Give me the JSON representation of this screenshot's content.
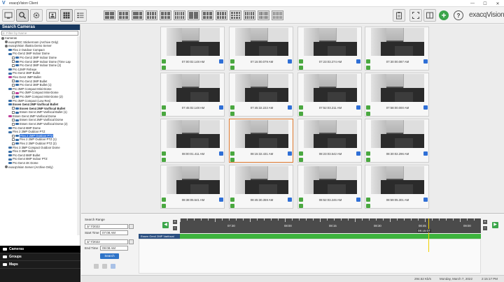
{
  "window": {
    "title": "exacqVision Client",
    "minimize": "—",
    "maximize": "☐",
    "close": "✕"
  },
  "toolbar": {
    "brand": "exacqVision",
    "help": "?",
    "plus": "+"
  },
  "search_panel": {
    "title": "Search Cameras",
    "filter_placeholder": "Filter by Name",
    "tree": [
      {
        "label": "Cameras",
        "kind": "root",
        "indent": 0
      },
      {
        "label": "exacqREC Stickerroom (Archive Only)",
        "kind": "server",
        "indent": 1
      },
      {
        "label": "exacqVision Illustra Demo Server",
        "kind": "server",
        "indent": 1
      },
      {
        "label": "Flex 2 Outdoor Compact",
        "kind": "cam",
        "indent": 2
      },
      {
        "label": "Pro Gen2 3MP Indoor Dome",
        "kind": "cam",
        "indent": 2
      },
      {
        "label": "Pro Gen2 3MP Indoor Dome",
        "kind": "cam",
        "indent": 3
      },
      {
        "label": "Pro Gen2 3MP Indoor Dome (Time Lap",
        "kind": "cam",
        "indent": 3
      },
      {
        "label": "Pro Gen2 3MP Indoor Dome (2)",
        "kind": "cam",
        "indent": 3
      },
      {
        "label": "Pro 12MP Fisheye",
        "kind": "cam",
        "indent": 2
      },
      {
        "label": "Pro Gen2 3MP Bullet",
        "kind": "cam",
        "indent": 2
      },
      {
        "label": "Flex Gen2 3MP Bullet",
        "kind": "cam-pink",
        "indent": 2
      },
      {
        "label": "Pro Gen2 3MP Bullet",
        "kind": "cam",
        "indent": 3
      },
      {
        "label": "Pro Gen2 3MP Bullet (1)",
        "kind": "cam",
        "indent": 3
      },
      {
        "label": "Pro 3MP Compact Mini-Dome",
        "kind": "cam",
        "indent": 2
      },
      {
        "label": "Pro 3MP Compact Mini-Dome",
        "kind": "cam-pink",
        "indent": 3
      },
      {
        "label": "Pro 3MP Compact Mini-Dome (2)",
        "kind": "cam",
        "indent": 3
      },
      {
        "label": "Pro 3MP Compact (Low Res)",
        "kind": "cam",
        "indent": 2
      },
      {
        "label": "Essen Gen4 2MP Varifocal Bullet",
        "kind": "cam",
        "indent": 2,
        "bold": true
      },
      {
        "label": "Essen Gen4 2MP Varifocal Bullet",
        "kind": "cam",
        "indent": 3,
        "bold": true
      },
      {
        "label": "Essen Gen4 2MP Varifocal Bullet (1)",
        "kind": "cam",
        "indent": 3
      },
      {
        "label": "Essen Gen4 2MP Varifocal Dome",
        "kind": "cam-pink",
        "indent": 2
      },
      {
        "label": "Essen Gen4 2MP Varifocal Dome",
        "kind": "cam",
        "indent": 3
      },
      {
        "label": "Essen Gen4 2MP Varifocal Dome (2)",
        "kind": "cam",
        "indent": 3
      },
      {
        "label": "Pro Gen3 8MP Dome",
        "kind": "cam",
        "indent": 2
      },
      {
        "label": "Flex 2 2MP Outdoor PTZ",
        "kind": "cam",
        "indent": 2
      },
      {
        "label": "Flex 2 2MP Outdoor PTZ",
        "kind": "cam",
        "indent": 3,
        "highlight": true
      },
      {
        "label": "Flex 2 2MP Outdoor PTZ (1)",
        "kind": "cam",
        "indent": 3
      },
      {
        "label": "Flex 2 2MP Outdoor PTZ (2)",
        "kind": "cam",
        "indent": 3
      },
      {
        "label": "Flex 3 3MP Compact Outdoor Dome",
        "kind": "cam",
        "indent": 2
      },
      {
        "label": "Flex 3 3MP Bullet",
        "kind": "cam",
        "indent": 2
      },
      {
        "label": "Pro Gen3 8MP Bullet",
        "kind": "cam",
        "indent": 2
      },
      {
        "label": "Pro Gen4 8MP Indoor PTZ",
        "kind": "cam",
        "indent": 2
      },
      {
        "label": "Pro Gen4 4K Dome",
        "kind": "cam",
        "indent": 2
      },
      {
        "label": "exacqVision Server (Archive Only)",
        "kind": "server",
        "indent": 1
      }
    ]
  },
  "nav": [
    {
      "label": "Cameras",
      "active": true
    },
    {
      "label": "Groups",
      "active": false
    },
    {
      "label": "Maps",
      "active": false
    }
  ],
  "thumbnails": [
    "07:00:02.148 AM",
    "07:15:00.079 AM",
    "07:23:03.274 AM",
    "07:30:00.087 AM",
    "07:45:02.148 AM",
    "07:45:32.222 AM",
    "07:52:03.211 AM",
    "07:58:00.000 AM",
    "08:00:01.411 AM",
    "08:15:32.431 AM",
    "08:23:03.542 AM",
    "08:30:02.296 AM",
    "08:38:05.541 AM",
    "08:45:30.359 AM",
    "08:52:03.246 AM",
    "08:59:05.301 AM"
  ],
  "selected_thumbnail": 9,
  "search": {
    "range_label": "Search Range",
    "start_date": "3/ 7/2022",
    "start_time_label": "Start Time",
    "start_time": "07:08 AM",
    "end_date": "3/ 7/2022",
    "end_time_label": "End Time",
    "end_time": "09:08 AM",
    "search_button": "Search"
  },
  "timeline": {
    "ticks": [
      "07:30",
      "08:00",
      "08:15",
      "08:30",
      "08:45",
      "09:00"
    ],
    "marker_label": "08:15:07",
    "track_name": "Essen Gen4 2MP Varifocal",
    "prev": "◀",
    "next": "▶",
    "zoom_in": "+",
    "zoom_out": "−"
  },
  "status": {
    "rate": "294.52 Kb/s",
    "date": "Monday, March 7, 2022",
    "time": "2:15:17 PM"
  },
  "colors": {
    "nav_bg": "#1c1c1c",
    "panel_head": "#17385f",
    "accent_green": "#3ba54a",
    "accent_blue": "#2f74c8",
    "selection": "#e07a2f"
  }
}
